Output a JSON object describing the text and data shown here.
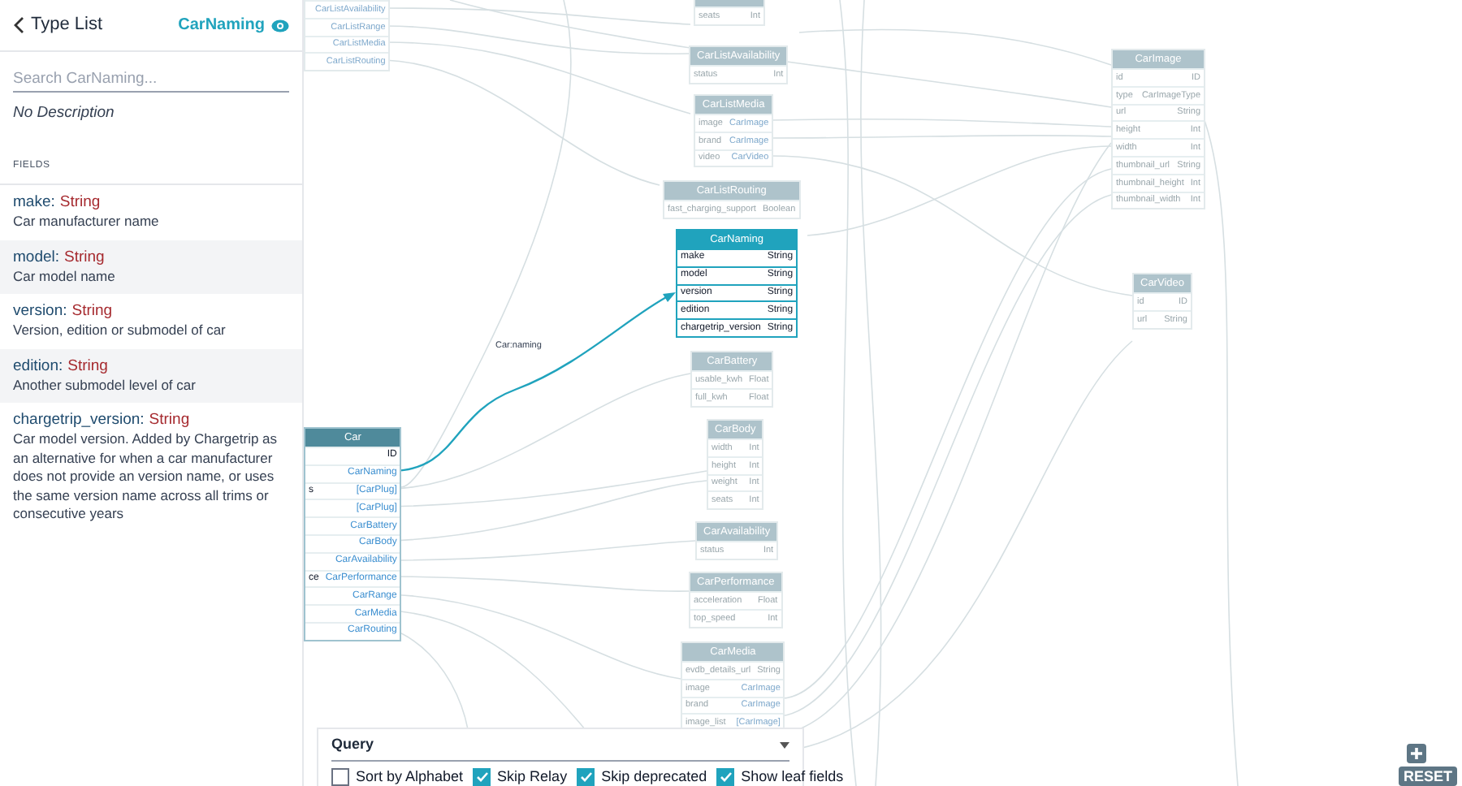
{
  "sidebar": {
    "back_link": "Type List",
    "type_name": "CarNaming",
    "search": {
      "placeholder": "Search CarNaming..."
    },
    "description": "No Description",
    "section_title": "FIELDS",
    "fields": [
      {
        "name": "make:",
        "type": "String",
        "description": "Car manufacturer name"
      },
      {
        "name": "model:",
        "type": "String",
        "description": "Car model name"
      },
      {
        "name": "version:",
        "type": "String",
        "description": "Version, edition or submodel of car"
      },
      {
        "name": "edition:",
        "type": "String",
        "description": "Another submodel level of car"
      },
      {
        "name": "chargetrip_version:",
        "type": "String",
        "description": "Car model version. Added by Chargetrip as an alternative for when a car manufacturer does not provide an version name, or uses the same version name across all trims or consecutive years"
      }
    ]
  },
  "graph": {
    "edge_label": "Car:naming",
    "nodes": [
      {
        "selected": false,
        "dimmed": true,
        "fields": [
          {
            "type": "CarListAvailability",
            "link": true
          },
          {
            "type": "CarListRange",
            "link": true
          },
          {
            "type": "CarListMedia",
            "link": true
          },
          {
            "type": "CarListRouting",
            "link": true
          }
        ]
      },
      {
        "selected": false,
        "dimmed": true,
        "fields": [
          {
            "name": "seats",
            "type": "Int",
            "link": false
          }
        ]
      },
      {
        "title": "CarListAvailability",
        "selected": false,
        "dimmed": true,
        "fields": [
          {
            "name": "status",
            "type": "Int",
            "link": false
          }
        ]
      },
      {
        "title": "CarListMedia",
        "selected": false,
        "dimmed": true,
        "fields": [
          {
            "name": "image",
            "type": "CarImage",
            "link": true
          },
          {
            "name": "brand",
            "type": "CarImage",
            "link": true
          },
          {
            "name": "video",
            "type": "CarVideo",
            "link": true
          }
        ]
      },
      {
        "title": "CarListRouting",
        "selected": false,
        "dimmed": true,
        "fields": [
          {
            "name": "fast_charging_support",
            "type": "Boolean",
            "link": false
          }
        ]
      },
      {
        "title": "CarNaming",
        "selected": true,
        "dimmed": false,
        "fields": [
          {
            "name": "make",
            "type": "String",
            "link": false
          },
          {
            "name": "model",
            "type": "String",
            "link": false
          },
          {
            "name": "version",
            "type": "String",
            "link": false
          },
          {
            "name": "edition",
            "type": "String",
            "link": false
          },
          {
            "name": "chargetrip_version",
            "type": "String",
            "link": false
          }
        ]
      },
      {
        "title": "CarBattery",
        "selected": false,
        "dimmed": true,
        "fields": [
          {
            "name": "usable_kwh",
            "type": "Float",
            "link": false
          },
          {
            "name": "full_kwh",
            "type": "Float",
            "link": false
          }
        ]
      },
      {
        "title": "CarBody",
        "selected": false,
        "dimmed": true,
        "fields": [
          {
            "name": "width",
            "type": "Int",
            "link": false
          },
          {
            "name": "height",
            "type": "Int",
            "link": false
          },
          {
            "name": "weight",
            "type": "Int",
            "link": false
          },
          {
            "name": "seats",
            "type": "Int",
            "link": false
          }
        ]
      },
      {
        "title": "CarAvailability",
        "selected": false,
        "dimmed": true,
        "fields": [
          {
            "name": "status",
            "type": "Int",
            "link": false
          }
        ]
      },
      {
        "title": "CarPerformance",
        "selected": false,
        "dimmed": true,
        "fields": [
          {
            "name": "acceleration",
            "type": "Float",
            "link": false
          },
          {
            "name": "top_speed",
            "type": "Int",
            "link": false
          }
        ]
      },
      {
        "title": "CarMedia",
        "selected": false,
        "dimmed": true,
        "fields": [
          {
            "name": "evdb_details_url",
            "type": "String",
            "link": false
          },
          {
            "name": "image",
            "type": "CarImage",
            "link": true
          },
          {
            "name": "brand",
            "type": "CarImage",
            "link": true
          },
          {
            "name": "image_list",
            "type": "[CarImage]",
            "link": true
          }
        ]
      },
      {
        "title": "CarImage",
        "selected": false,
        "dimmed": true,
        "fields": [
          {
            "name": "id",
            "type": "ID",
            "link": false
          },
          {
            "name": "type",
            "type": "CarImageType",
            "link": false
          },
          {
            "name": "url",
            "type": "String",
            "link": false
          },
          {
            "name": "height",
            "type": "Int",
            "link": false
          },
          {
            "name": "width",
            "type": "Int",
            "link": false
          },
          {
            "name": "thumbnail_url",
            "type": "String",
            "link": false
          },
          {
            "name": "thumbnail_height",
            "type": "Int",
            "link": false
          },
          {
            "name": "thumbnail_width",
            "type": "Int",
            "link": false
          }
        ]
      },
      {
        "title": "CarVideo",
        "selected": false,
        "dimmed": true,
        "fields": [
          {
            "name": "id",
            "type": "ID",
            "link": false
          },
          {
            "name": "url",
            "type": "String",
            "link": false
          }
        ]
      },
      {
        "title": "Car",
        "selected": false,
        "dimmed": false,
        "fields": [
          {
            "type": "ID",
            "link": false
          },
          {
            "type": "CarNaming",
            "link": true
          },
          {
            "name": "s",
            "type": "[CarPlug]",
            "link": true
          },
          {
            "type": "[CarPlug]",
            "link": true
          },
          {
            "type": "CarBattery",
            "link": true
          },
          {
            "type": "CarBody",
            "link": true
          },
          {
            "type": "CarAvailability",
            "link": true
          },
          {
            "name": "ce",
            "type": "CarPerformance",
            "link": true
          },
          {
            "type": "CarRange",
            "link": true
          },
          {
            "type": "CarMedia",
            "link": true
          },
          {
            "type": "CarRouting",
            "link": true
          }
        ]
      }
    ]
  },
  "query_panel": {
    "title": "Query",
    "options": [
      {
        "label": "Sort by Alphabet",
        "checked": false
      },
      {
        "label": "Skip Relay",
        "checked": true
      },
      {
        "label": "Skip deprecated",
        "checked": true
      },
      {
        "label": "Show leaf fields",
        "checked": true
      }
    ]
  },
  "controls": {
    "reset": "RESET"
  }
}
